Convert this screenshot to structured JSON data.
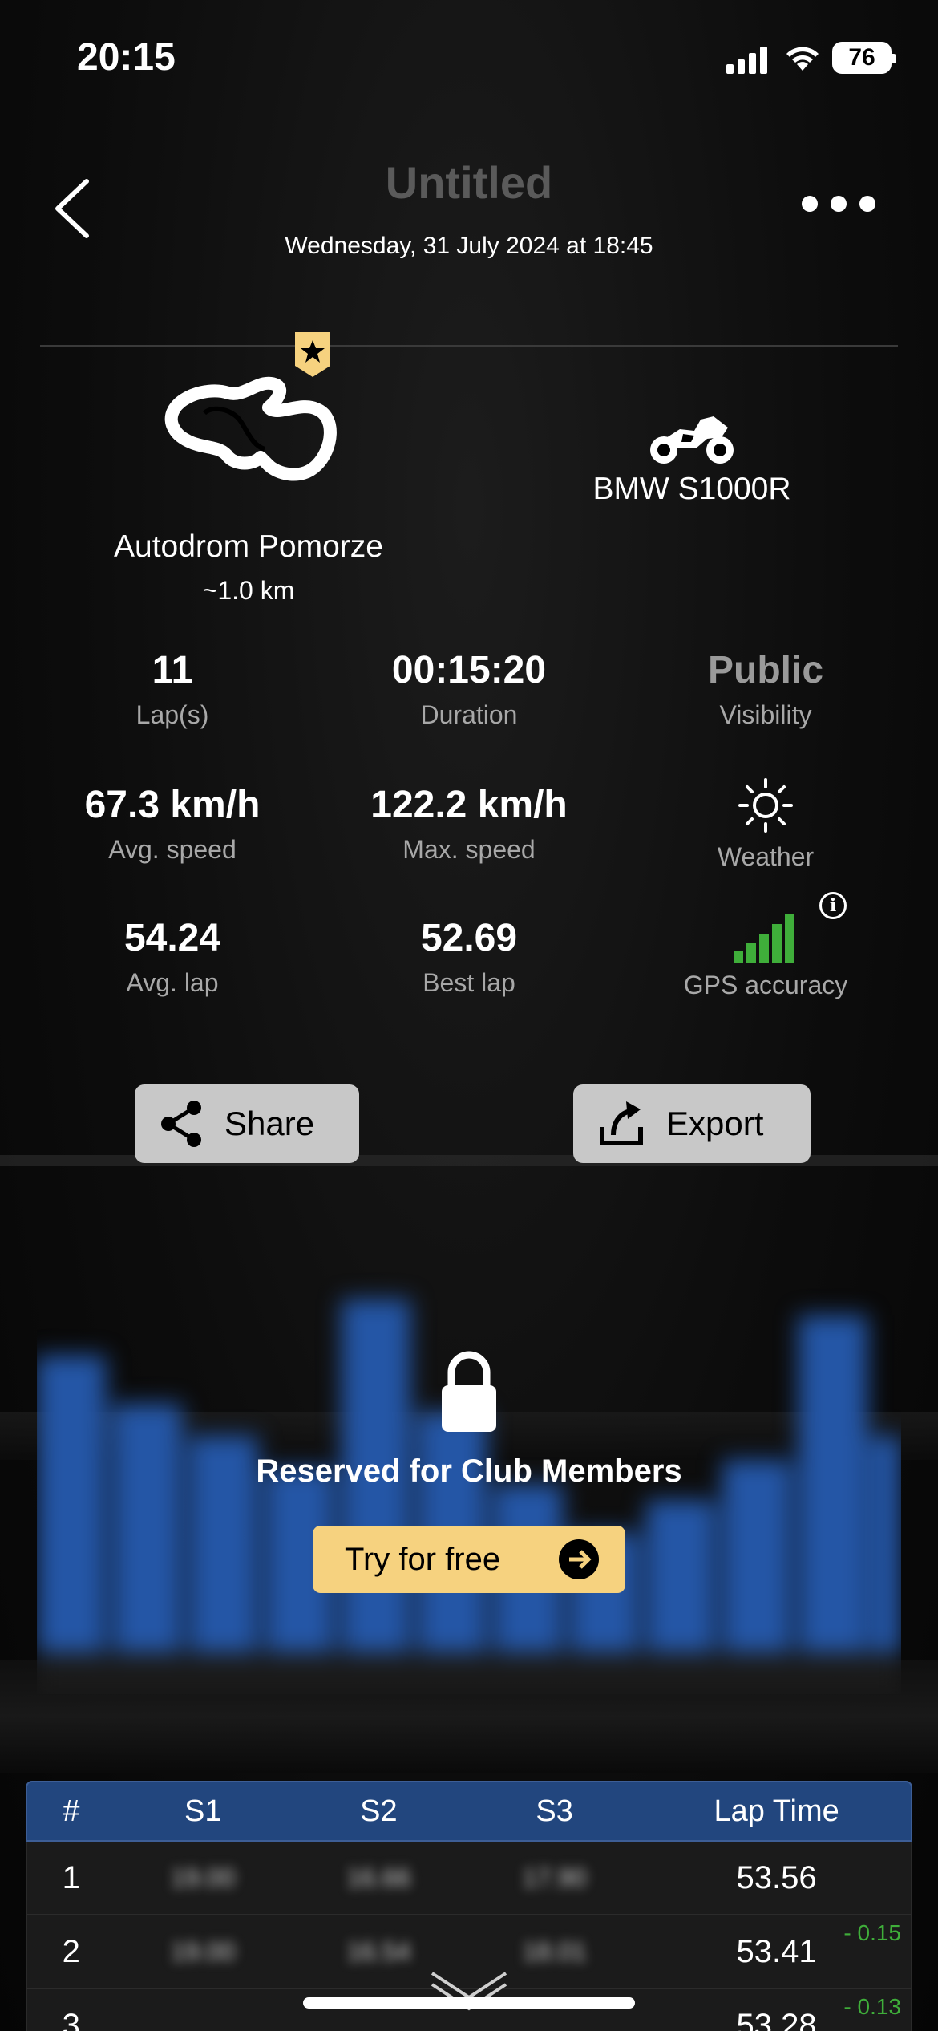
{
  "status": {
    "time": "20:15",
    "battery": "76"
  },
  "header": {
    "title": "Untitled",
    "subtitle": "Wednesday, 31 July 2024 at 18:45"
  },
  "track": {
    "name": "Autodrom Pomorze",
    "length": "~1.0 km"
  },
  "bike": {
    "name": "BMW S1000R"
  },
  "stats": {
    "laps": {
      "value": "11",
      "label": "Lap(s)"
    },
    "duration": {
      "value": "00:15:20",
      "label": "Duration"
    },
    "visibility": {
      "value": "Public",
      "label": "Visibility"
    },
    "avg_speed": {
      "value": "67.3 km/h",
      "label": "Avg. speed"
    },
    "max_speed": {
      "value": "122.2 km/h",
      "label": "Max. speed"
    },
    "weather": {
      "label": "Weather",
      "icon": "sun-icon"
    },
    "avg_lap": {
      "value": "54.24",
      "label": "Avg. lap"
    },
    "best_lap": {
      "value": "52.69",
      "label": "Best lap"
    },
    "gps": {
      "label": "GPS accuracy",
      "icon": "gps-signal-icon",
      "level": 5,
      "max": 5
    }
  },
  "buttons": {
    "share": "Share",
    "export": "Export"
  },
  "locked": {
    "message": "Reserved for Club Members",
    "cta": "Try for free"
  },
  "table": {
    "headers": [
      "#",
      "S1",
      "S2",
      "S3",
      "Lap Time"
    ],
    "rows": [
      {
        "n": "1",
        "s1": "19.00",
        "s2": "16.66",
        "s3": "17.90",
        "lap": "53.56",
        "delta": ""
      },
      {
        "n": "2",
        "s1": "19.00",
        "s2": "16.54",
        "s3": "18.01",
        "lap": "53.41",
        "delta": "- 0.15"
      },
      {
        "n": "3",
        "s1": "",
        "s2": "",
        "s3": "",
        "lap": "53.28",
        "delta": "- 0.13"
      }
    ]
  },
  "colors": {
    "accent_blue": "#22467e",
    "cta_yellow": "#f6d27f",
    "gps_green": "#3fae3a",
    "badge_gold": "#f6d27f"
  }
}
